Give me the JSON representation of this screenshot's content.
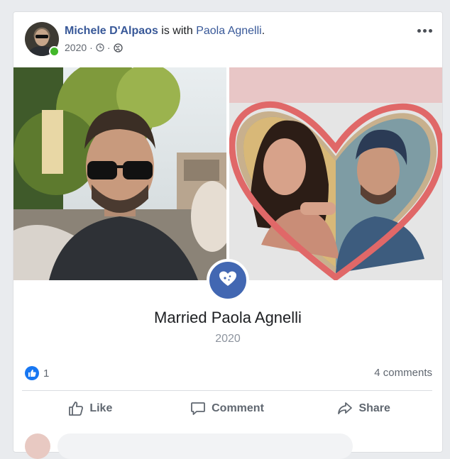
{
  "post": {
    "author": "Michele D'Alpaos",
    "is_with": "is with",
    "tagged": "Paola Agnelli",
    "period": ".",
    "date": "2020",
    "separator": "·"
  },
  "life_event": {
    "title": "Married Paola Agnelli",
    "year": "2020"
  },
  "footer": {
    "reaction_count": "1",
    "comments": "4 comments",
    "like_label": "Like",
    "comment_label": "Comment",
    "share_label": "Share"
  },
  "colors": {
    "link": "#385898",
    "brand": "#4267b2",
    "online": "#42b72a",
    "like_blue": "#1877f2"
  },
  "icons": {
    "more": "more-options-icon",
    "clock": "clock-icon",
    "globe": "globe-icon",
    "heart": "heart-icon",
    "like_reaction": "thumbs-up-icon",
    "like_action": "thumbs-up-outline-icon",
    "comment_action": "speech-bubble-icon",
    "share_action": "share-arrow-icon"
  }
}
